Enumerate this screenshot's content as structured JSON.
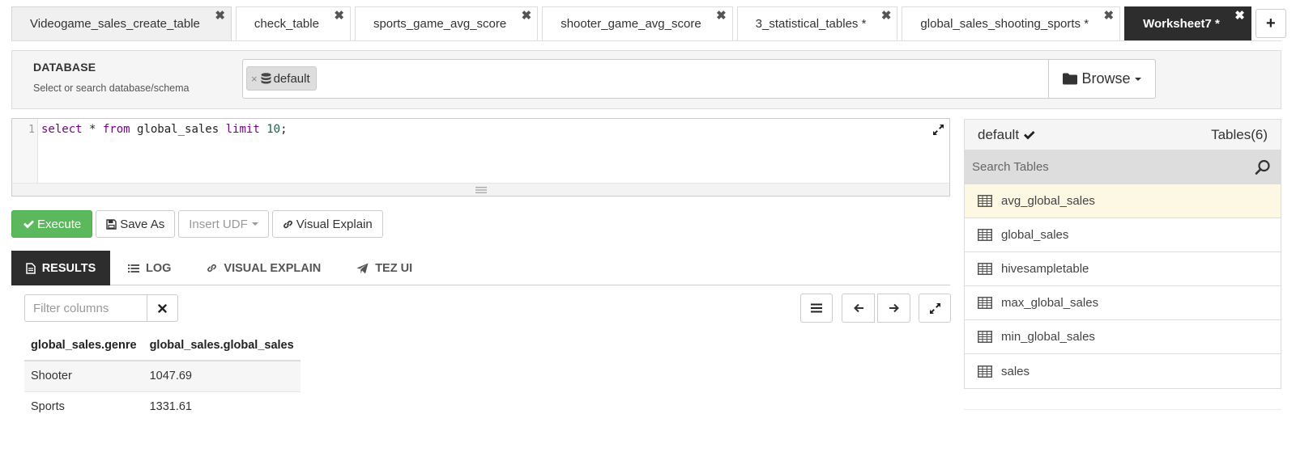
{
  "tabs": [
    {
      "label": "Videogame_sales_create_table"
    },
    {
      "label": "check_table"
    },
    {
      "label": "sports_game_avg_score"
    },
    {
      "label": "shooter_game_avg_score"
    },
    {
      "label": "3_statistical_tables *"
    },
    {
      "label": "global_sales_shooting_sports *"
    },
    {
      "label": "Worksheet7 *",
      "active": true
    }
  ],
  "add_tab_label": "+",
  "database": {
    "title": "DATABASE",
    "subtitle": "Select or search database/schema",
    "selected": "default",
    "chip_remove": "×",
    "browse_label": "Browse"
  },
  "editor": {
    "line_number": "1",
    "tokens": [
      {
        "text": "select",
        "kind": "kw"
      },
      {
        "text": " * ",
        "kind": "plain"
      },
      {
        "text": "from",
        "kind": "kw"
      },
      {
        "text": " global_sales ",
        "kind": "plain"
      },
      {
        "text": "limit",
        "kind": "kw"
      },
      {
        "text": " ",
        "kind": "plain"
      },
      {
        "text": "10",
        "kind": "num"
      },
      {
        "text": ";",
        "kind": "plain"
      }
    ]
  },
  "toolbar": {
    "execute": "Execute",
    "save_as": "Save As",
    "insert_udf": "Insert UDF",
    "visual_explain": "Visual Explain"
  },
  "result_tabs": {
    "results": "RESULTS",
    "log": "LOG",
    "visual_explain": "VISUAL EXPLAIN",
    "tez_ui": "TEZ UI"
  },
  "filter": {
    "placeholder": "Filter columns"
  },
  "results": {
    "columns": [
      "global_sales.genre",
      "global_sales.global_sales"
    ],
    "rows": [
      [
        "Shooter",
        "1047.69"
      ],
      [
        "Sports",
        "1331.61"
      ]
    ]
  },
  "tables_panel": {
    "database": "default",
    "count_label": "Tables(6)",
    "search_placeholder": "Search Tables",
    "items": [
      "avg_global_sales",
      "global_sales",
      "hivesampletable",
      "max_global_sales",
      "min_global_sales",
      "sales"
    ],
    "highlighted": "avg_global_sales"
  },
  "colors": {
    "execute_green": "#5cb85c",
    "active_tab_dark": "#2d2d2d",
    "highlight_row": "#fcf8e3",
    "sql_keyword": "#770088",
    "sql_number": "#116644"
  },
  "icons": {
    "tab_close": "close-icon",
    "chip": "database-icon",
    "browse": "folder-icon",
    "expand": "expand-icon",
    "execute": "check-icon",
    "save": "save-icon",
    "visual_explain": "link-icon",
    "results": "file-icon",
    "log": "list-icon",
    "tez": "send-icon",
    "table": "table-icon",
    "search": "search-icon"
  }
}
